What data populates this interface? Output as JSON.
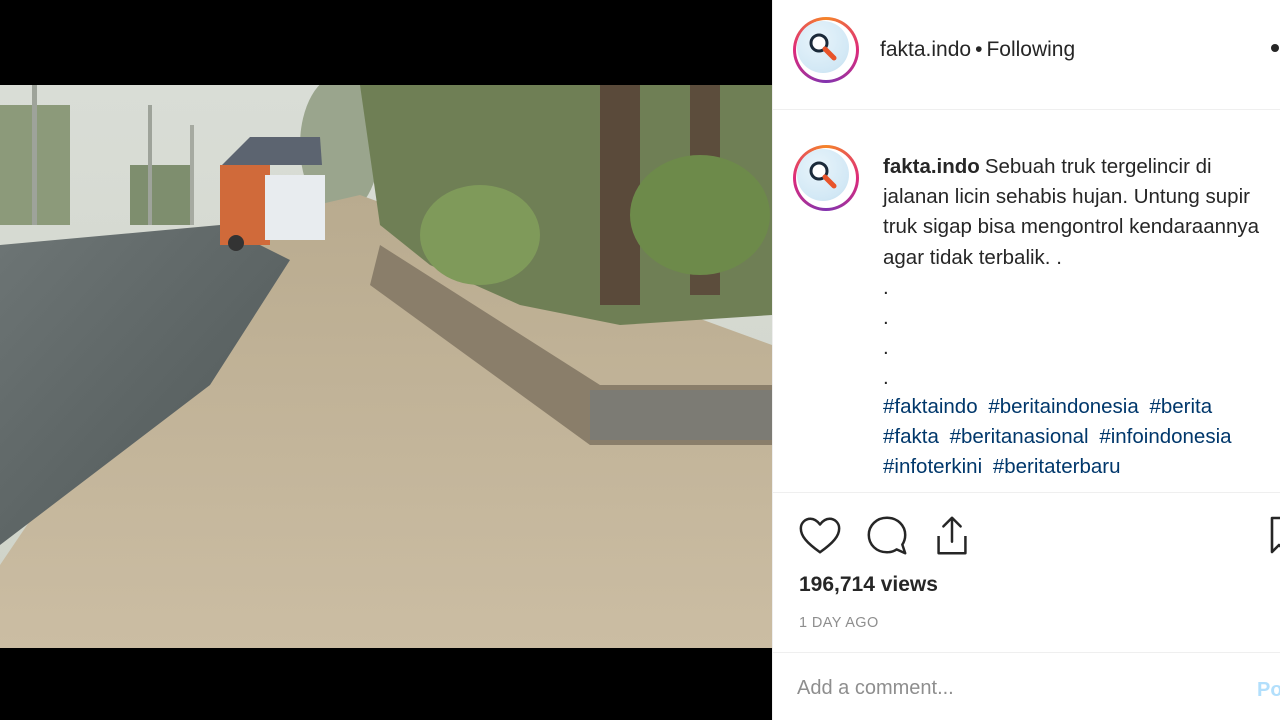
{
  "post": {
    "username": "fakta.indo",
    "separator": "•",
    "follow_state": "Following",
    "more_icon": "more-options-icon"
  },
  "caption": {
    "username": "fakta.indo",
    "text": "Sebuah truk tergelincir di jalanan licin sehabis hujan. Untung supir truk sigap bisa mengontrol kendaraannya agar tidak terbalik. .\n.\n.\n.\n.",
    "hashtags": [
      "#faktaindo",
      "#beritaindonesia",
      "#berita",
      "#fakta",
      "#beritanasional",
      "#infoindonesia",
      "#infoterkini",
      "#beritaterbaru"
    ]
  },
  "actions": {
    "icons": [
      "heart-icon",
      "comment-icon",
      "share-icon",
      "bookmark-icon"
    ]
  },
  "stats": {
    "views": "196,714 views",
    "time_ago": "1 DAY AGO"
  },
  "comment_box": {
    "placeholder": "Add a comment...",
    "post_label": "Post"
  },
  "colors": {
    "hashtag": "#00376b",
    "muted": "#8e8e8e",
    "post_disabled": "#b2dffc",
    "ring": "#dd2a7b"
  }
}
